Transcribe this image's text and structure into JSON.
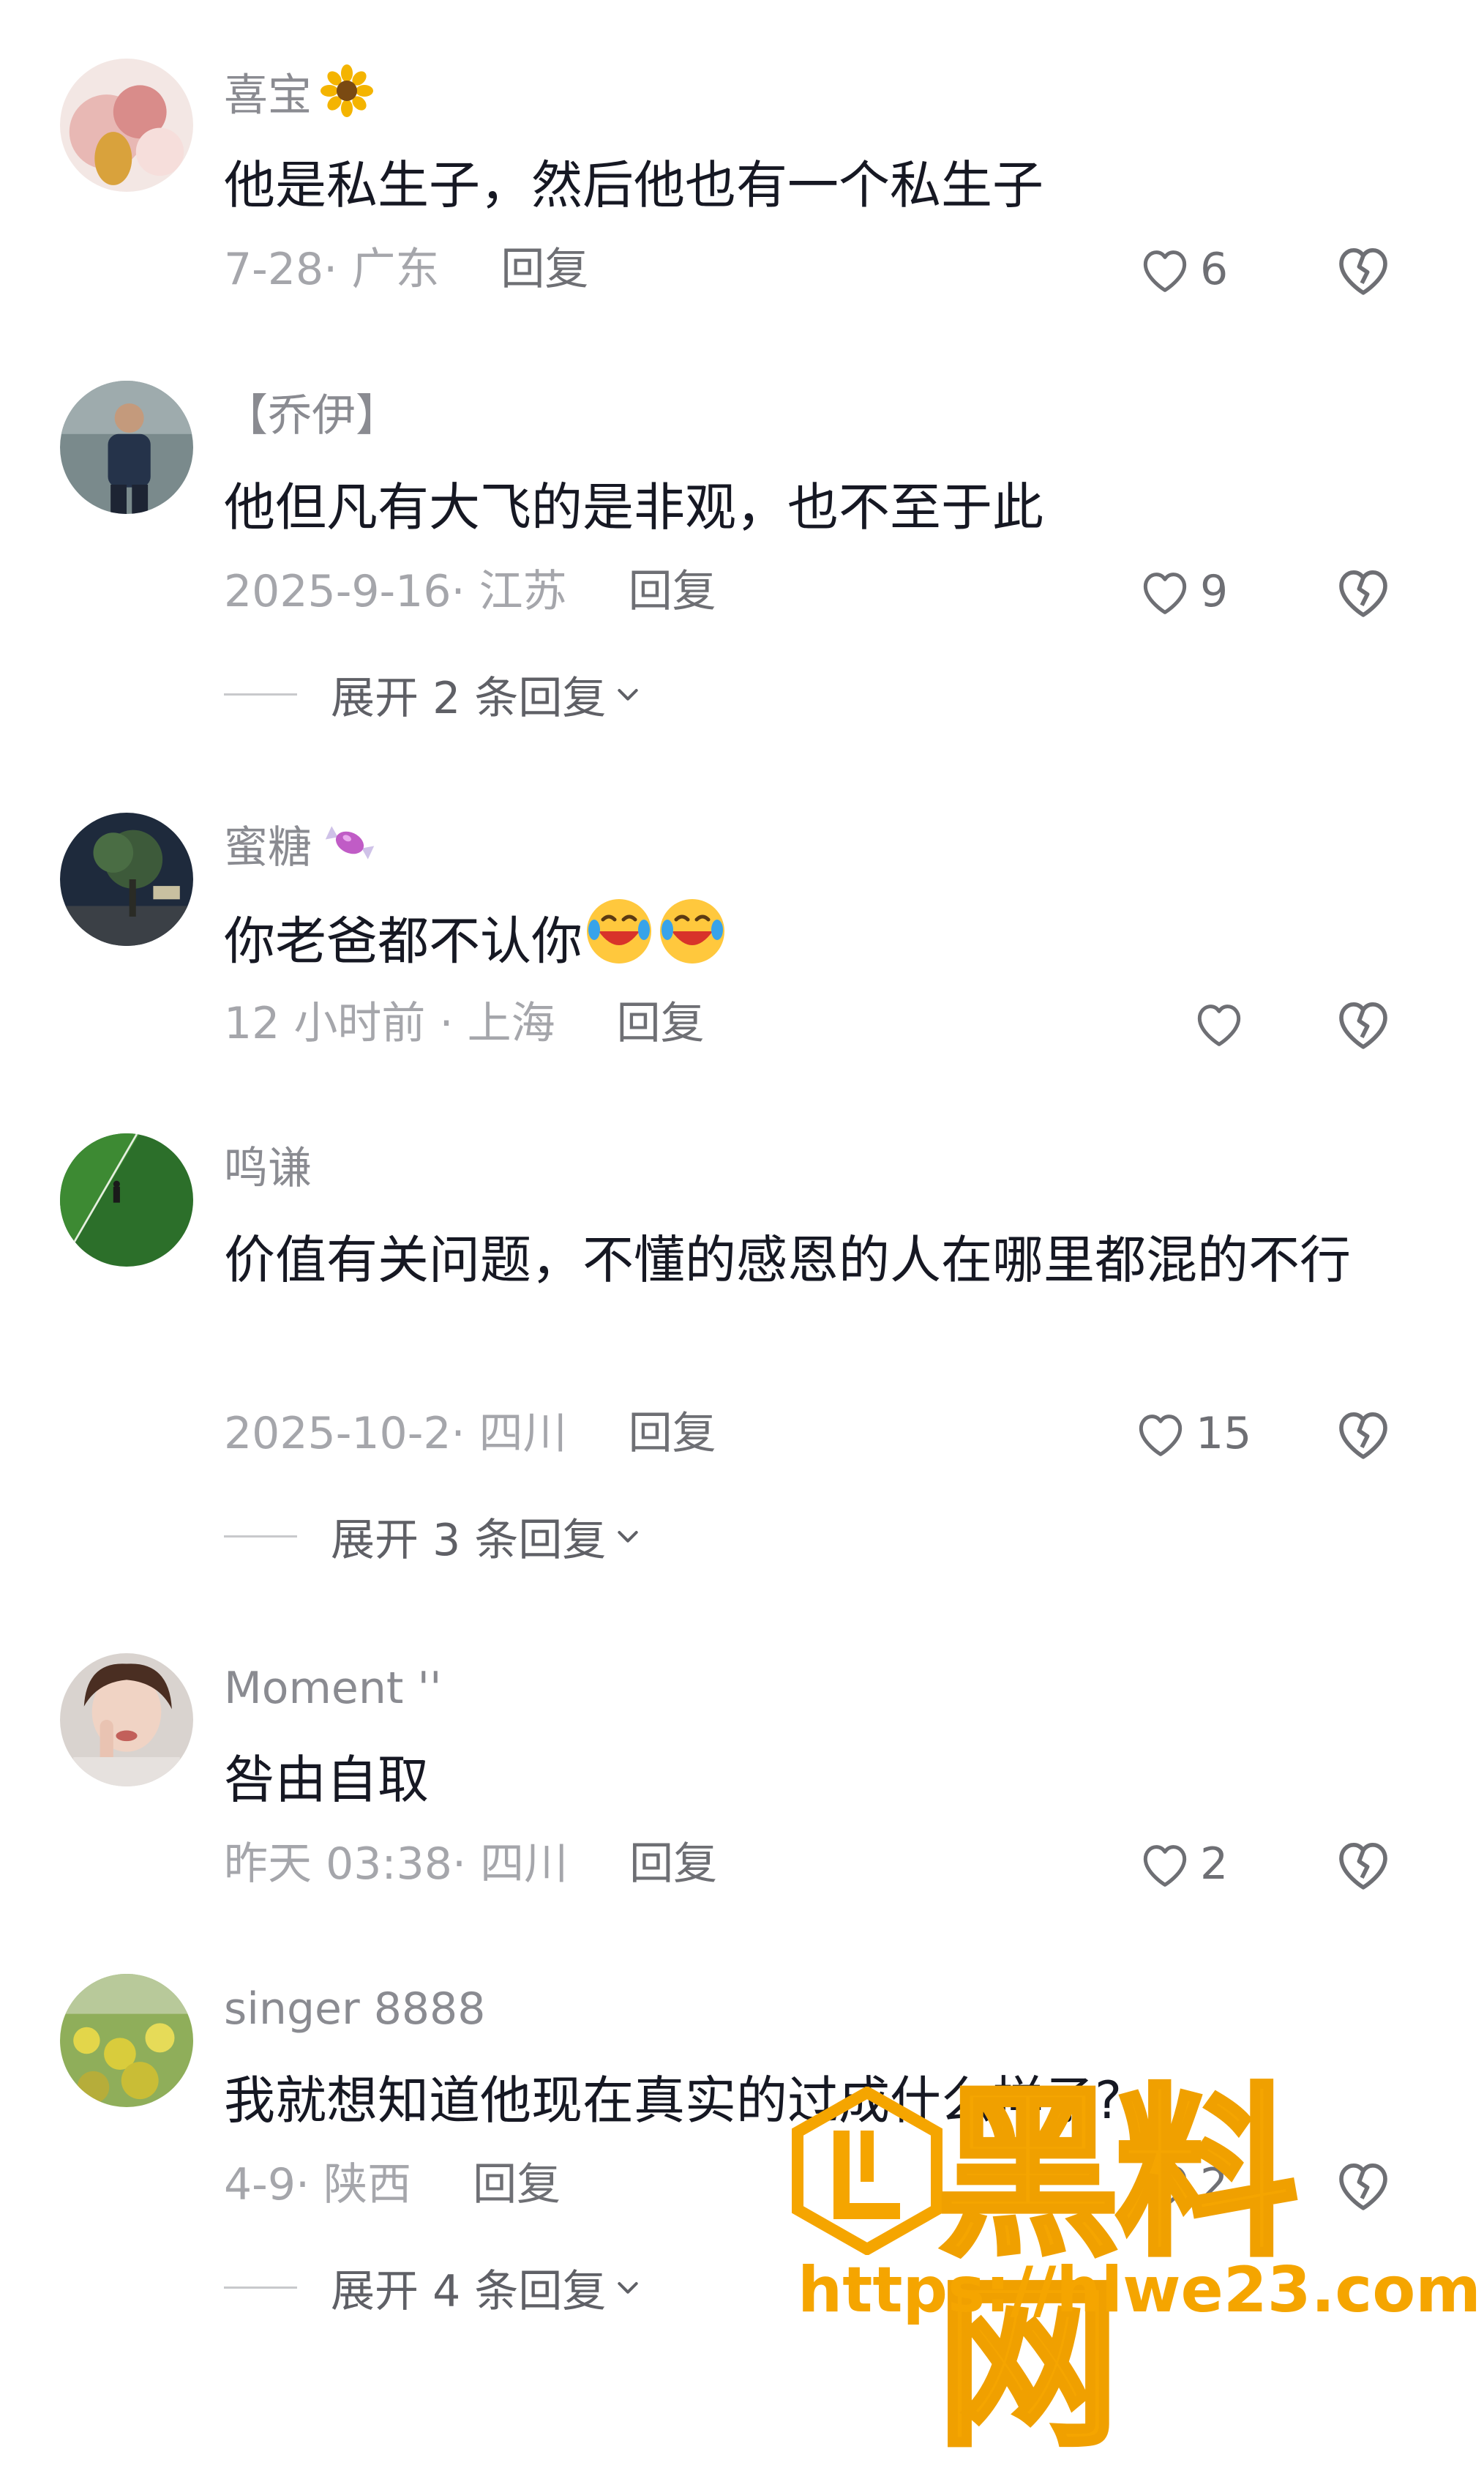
{
  "comments": [
    {
      "username": "喜宝",
      "username_emoji": "sunflower",
      "avatar": "pink-flower-photo",
      "content": "他是私生子，然后他也有一个私生子",
      "meta": "7-28· 广东",
      "reply_label": "回复",
      "likes": "6"
    },
    {
      "username": "【乔伊】",
      "avatar": "man-standing-photo",
      "content": "他但凡有大飞的是非观，也不至于此",
      "meta": "2025-9-16· 江苏",
      "reply_label": "回复",
      "likes": "9",
      "expand": "展开 2 条回复"
    },
    {
      "username": "蜜糖",
      "username_emoji": "candy",
      "avatar": "night-tree-photo",
      "content": "你老爸都不认你",
      "content_emoji": [
        "laughing-crying",
        "laughing-crying"
      ],
      "meta": "12 小时前 · 上海",
      "reply_label": "回复",
      "likes": ""
    },
    {
      "username": "鸣谦",
      "avatar": "green-field-photo",
      "content": "价值有关问题，不懂的感恩的人在哪里都混的不行",
      "meta": "2025-10-2· 四川",
      "reply_label": "回复",
      "likes": "15",
      "expand": "展开 3 条回复"
    },
    {
      "username": "Moment ''",
      "avatar": "woman-portrait-photo",
      "content": "咎由自取",
      "meta": "昨天 03:38· 四川",
      "reply_label": "回复",
      "likes": "2"
    },
    {
      "username": "singer 8888",
      "avatar": "yellow-flower-field-photo",
      "content": "我就想知道他现在真实的过成什么样子?",
      "meta": "4-9· 陕西",
      "reply_label": "回复",
      "likes": "2",
      "expand": "展开 4 条回复"
    }
  ],
  "watermark": {
    "title": "黑料网",
    "url": "https://hlwe23.com",
    "color": "#f5a500"
  },
  "icons": {
    "like": "heart-outline-icon",
    "dislike": "broken-heart-icon",
    "expand": "chevron-down-icon"
  }
}
